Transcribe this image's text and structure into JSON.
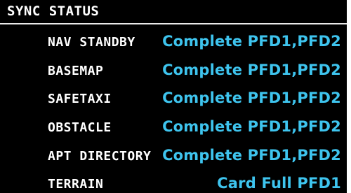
{
  "header": {
    "title": "SYNC STATUS"
  },
  "colors": {
    "background": "#000000",
    "label": "#ffffff",
    "status": "#3ec4ee"
  },
  "rows": [
    {
      "label": "NAV STANDBY",
      "status": "Complete PFD1,PFD2"
    },
    {
      "label": "BASEMAP",
      "status": "Complete PFD1,PFD2"
    },
    {
      "label": "SAFETAXI",
      "status": "Complete PFD1,PFD2"
    },
    {
      "label": "OBSTACLE",
      "status": "Complete PFD1,PFD2"
    },
    {
      "label": "APT DIRECTORY",
      "status": "Complete PFD1,PFD2"
    },
    {
      "label": "TERRAIN",
      "status": "Card Full PFD1"
    }
  ]
}
